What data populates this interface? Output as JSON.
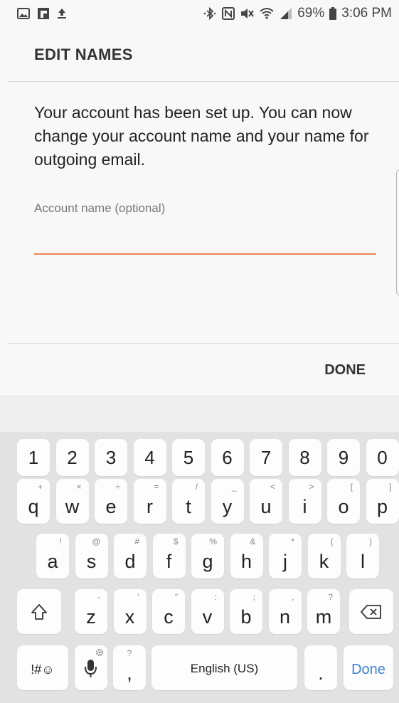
{
  "status_bar": {
    "battery": "69%",
    "time": "3:06 PM"
  },
  "dialog": {
    "title": "EDIT NAMES",
    "message": "Your account has been set up. You can now change your account name and your name for outgoing email.",
    "account_name_label": "Account name (optional)",
    "account_name_value": "",
    "done_label": "DONE"
  },
  "keyboard": {
    "number_row": [
      "1",
      "2",
      "3",
      "4",
      "5",
      "6",
      "7",
      "8",
      "9",
      "0"
    ],
    "row1": [
      {
        "key": "q",
        "hint": "+"
      },
      {
        "key": "w",
        "hint": "×"
      },
      {
        "key": "e",
        "hint": "÷"
      },
      {
        "key": "r",
        "hint": "="
      },
      {
        "key": "t",
        "hint": "/"
      },
      {
        "key": "y",
        "hint": "_"
      },
      {
        "key": "u",
        "hint": "<"
      },
      {
        "key": "i",
        "hint": ">"
      },
      {
        "key": "o",
        "hint": "["
      },
      {
        "key": "p",
        "hint": "]"
      }
    ],
    "row2": [
      {
        "key": "a",
        "hint": "!"
      },
      {
        "key": "s",
        "hint": "@"
      },
      {
        "key": "d",
        "hint": "#"
      },
      {
        "key": "f",
        "hint": "$"
      },
      {
        "key": "g",
        "hint": "%"
      },
      {
        "key": "h",
        "hint": "&"
      },
      {
        "key": "j",
        "hint": "*"
      },
      {
        "key": "k",
        "hint": "("
      },
      {
        "key": "l",
        "hint": ")"
      }
    ],
    "row3": [
      {
        "key": "z",
        "hint": "-"
      },
      {
        "key": "x",
        "hint": "'"
      },
      {
        "key": "c",
        "hint": "\""
      },
      {
        "key": "v",
        "hint": ":"
      },
      {
        "key": "b",
        "hint": ";"
      },
      {
        "key": "n",
        "hint": ","
      },
      {
        "key": "m",
        "hint": "?"
      }
    ],
    "symbols_label": "!#☺",
    "comma_key": ",",
    "comma_hint": "?",
    "space_label": "English (US)",
    "period_key": ".",
    "done_key_label": "Done",
    "accent_color": "#3b82d8"
  }
}
